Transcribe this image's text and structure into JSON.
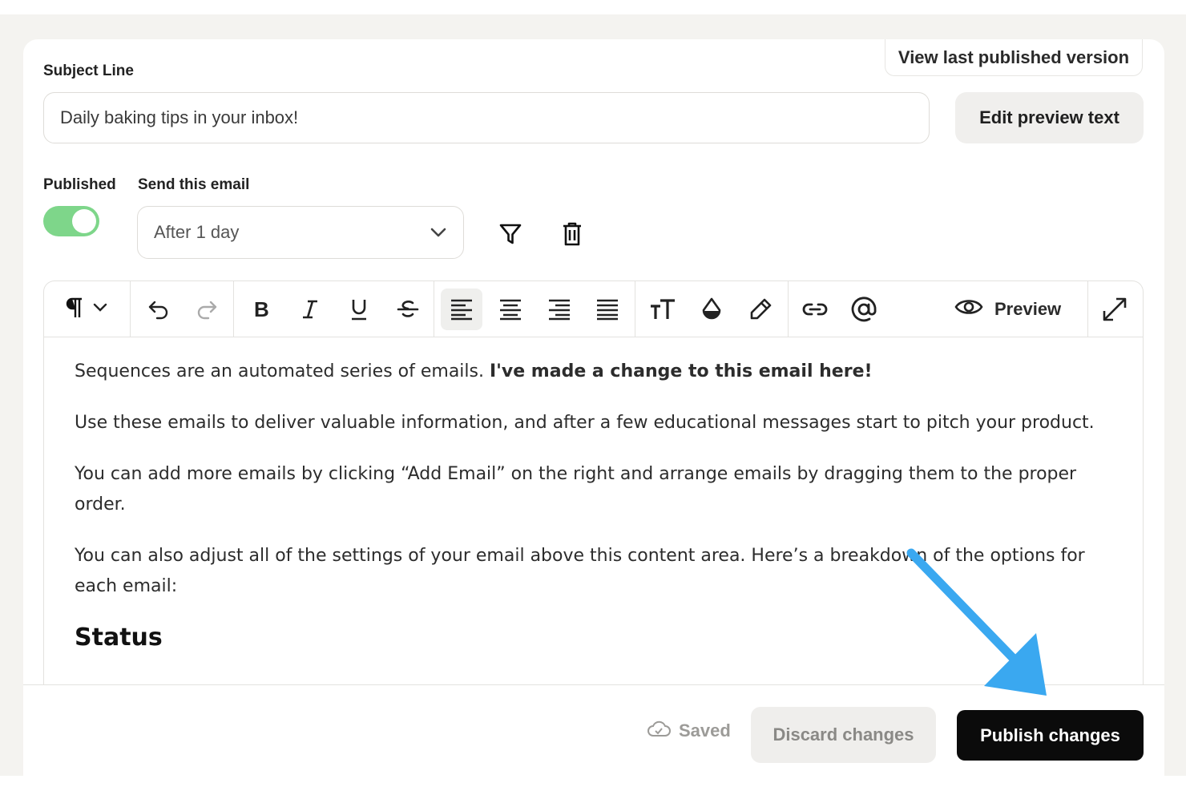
{
  "header": {
    "view_last_published": "View last published version"
  },
  "subject": {
    "label": "Subject Line",
    "value": "Daily baking tips in your inbox!",
    "edit_preview_label": "Edit preview text"
  },
  "settings": {
    "published_label": "Published",
    "published_on": true,
    "send_label": "Send this email",
    "send_value": "After 1 day"
  },
  "toolbar": {
    "preview_label": "Preview",
    "icons": [
      "paragraph-icon",
      "undo-icon",
      "redo-icon",
      "bold-icon",
      "italic-icon",
      "underline-icon",
      "strikethrough-icon",
      "align-left-icon",
      "align-center-icon",
      "align-right-icon",
      "align-justify-icon",
      "text-size-icon",
      "text-color-icon",
      "highlight-icon",
      "link-icon",
      "mention-icon",
      "eye-icon",
      "expand-icon"
    ]
  },
  "content": {
    "p1_normal": "Sequences are an automated series of emails. ",
    "p1_bold": "I've made a change to this email here!",
    "p2": "Use these emails to deliver valuable information, and after a few educational messages start to pitch your product.",
    "p3": "You can add more emails by clicking “Add Email” on the right and arrange emails by dragging them to the proper order.",
    "p4": "You can also adjust all of the settings of your email above this content area. Here’s a breakdown of the options for each email:",
    "heading": "Status"
  },
  "footer": {
    "saved_label": "Saved",
    "discard_label": "Discard changes",
    "publish_label": "Publish changes"
  },
  "colors": {
    "toggle_on": "#7ed68a",
    "publish_bg": "#0b0b0b",
    "annotation_arrow": "#3aa8f0"
  }
}
